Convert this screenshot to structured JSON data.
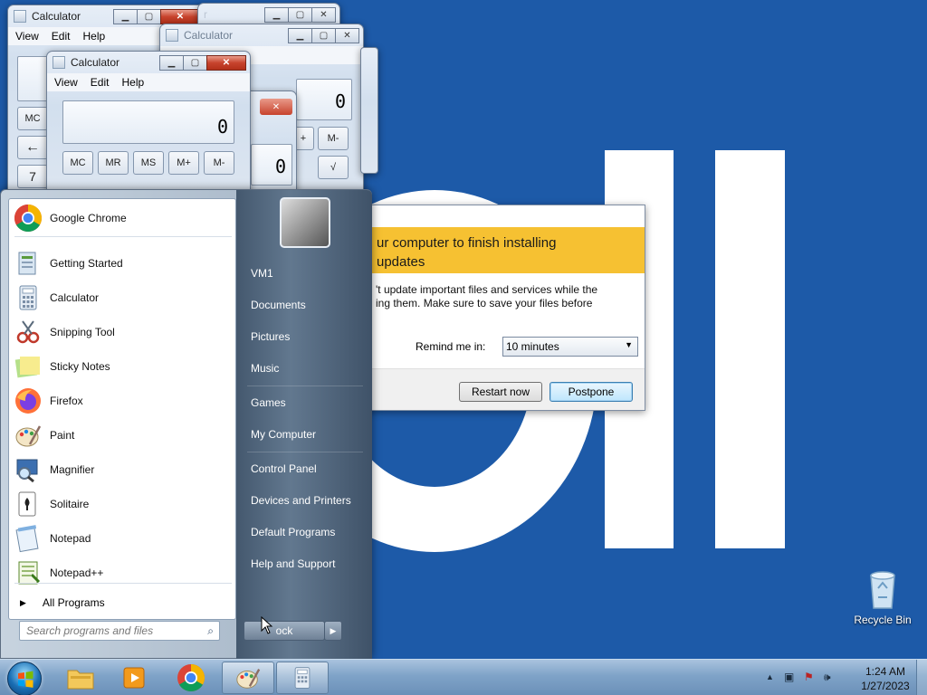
{
  "calc_windows": [
    {
      "title": "Calculator",
      "menu": [
        "View",
        "Edit",
        "Help"
      ],
      "buttons": [
        "MC",
        "←",
        "7"
      ]
    },
    {
      "title_partial": "r"
    },
    {
      "title": "Calculator",
      "menu_partial": "lp",
      "display": "0",
      "buttons": [
        "+",
        "M-",
        "√"
      ]
    },
    {
      "title": "Calculator",
      "menu": [
        "View",
        "Edit",
        "Help"
      ],
      "display": "0",
      "buttons": [
        "MC",
        "MR",
        "MS",
        "M+",
        "M-"
      ]
    },
    {
      "display": "0"
    }
  ],
  "update_dialog": {
    "banner_line1": "ur computer to finish installing",
    "banner_line2": "updates",
    "body_line1": "'t update important files and services while the",
    "body_line2": "ing them. Make sure to save your files before",
    "remind_label": "Remind me in:",
    "remind_value": "10 minutes",
    "restart_label": "Restart now",
    "postpone_label": "Postpone"
  },
  "start_menu": {
    "pinned": [
      {
        "label": "Google Chrome",
        "icon": "chrome-icon"
      }
    ],
    "programs": [
      {
        "label": "Getting Started",
        "icon": "getting-started-icon"
      },
      {
        "label": "Calculator",
        "icon": "calculator-icon"
      },
      {
        "label": "Snipping Tool",
        "icon": "snipping-tool-icon"
      },
      {
        "label": "Sticky Notes",
        "icon": "sticky-notes-icon"
      },
      {
        "label": "Firefox",
        "icon": "firefox-icon"
      },
      {
        "label": "Paint",
        "icon": "paint-icon"
      },
      {
        "label": "Magnifier",
        "icon": "magnifier-icon"
      },
      {
        "label": "Solitaire",
        "icon": "solitaire-icon"
      },
      {
        "label": "Notepad",
        "icon": "notepad-icon"
      },
      {
        "label": "Notepad++",
        "icon": "notepad-plus-plus-icon"
      }
    ],
    "all_programs": "All Programs",
    "search_placeholder": "Search programs and files",
    "right_links": [
      "VM1",
      "Documents",
      "Pictures",
      "Music",
      "Games",
      "My Computer",
      "Control Panel",
      "Devices and Printers",
      "Default Programs",
      "Help and Support"
    ],
    "shutdown_label": "ock"
  },
  "desktop": {
    "recycle_bin_label": "Recycle Bin",
    "background_color": "#1d5aa8"
  },
  "taskbar": {
    "apps": [
      "explorer-icon",
      "media-player-icon",
      "chrome-icon",
      "paint-icon",
      "calculator-icon"
    ],
    "time": "1:24 AM",
    "date": "1/27/2023"
  }
}
